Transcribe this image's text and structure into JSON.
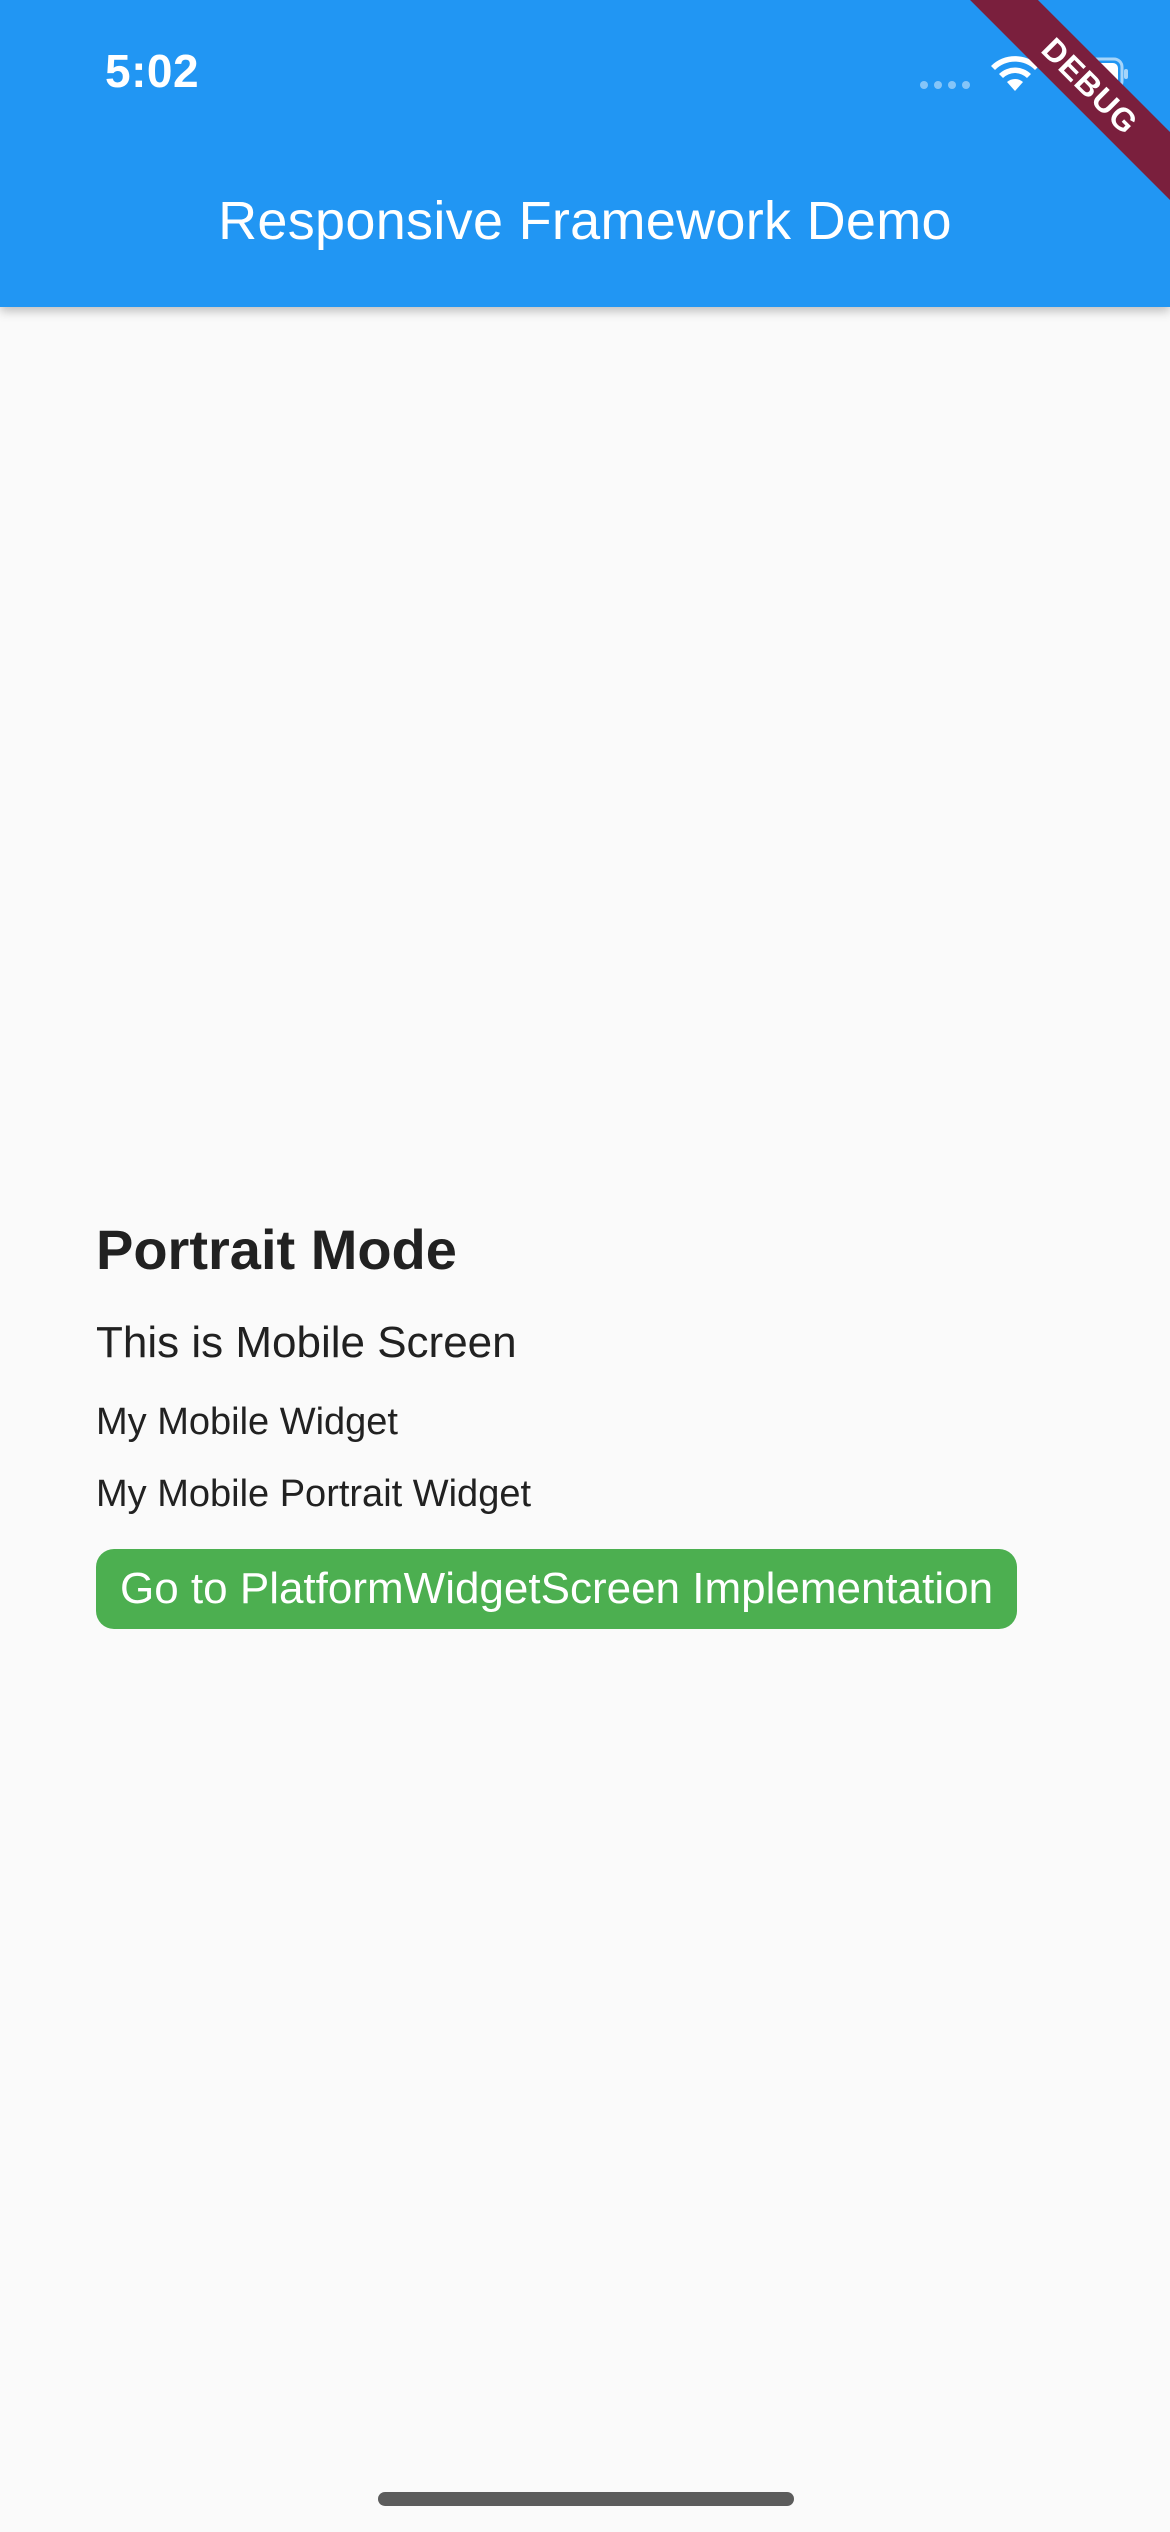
{
  "status_bar": {
    "time": "5:02",
    "icons": [
      "signal-icon",
      "wifi-icon",
      "battery-icon"
    ]
  },
  "app_bar": {
    "title": "Responsive Framework Demo",
    "background_color": "#2196f3"
  },
  "debug_banner": {
    "label": "DEBUG",
    "color": "#7a1f3d"
  },
  "content": {
    "orientation_title": "Portrait Mode",
    "screen_label": "This is Mobile Screen",
    "widget_label": "My Mobile Widget",
    "portrait_widget_label": "My Mobile Portrait Widget",
    "navigate_button_label": "Go to PlatformWidgetScreen Implementation",
    "navigate_button_color": "#4caf50"
  }
}
